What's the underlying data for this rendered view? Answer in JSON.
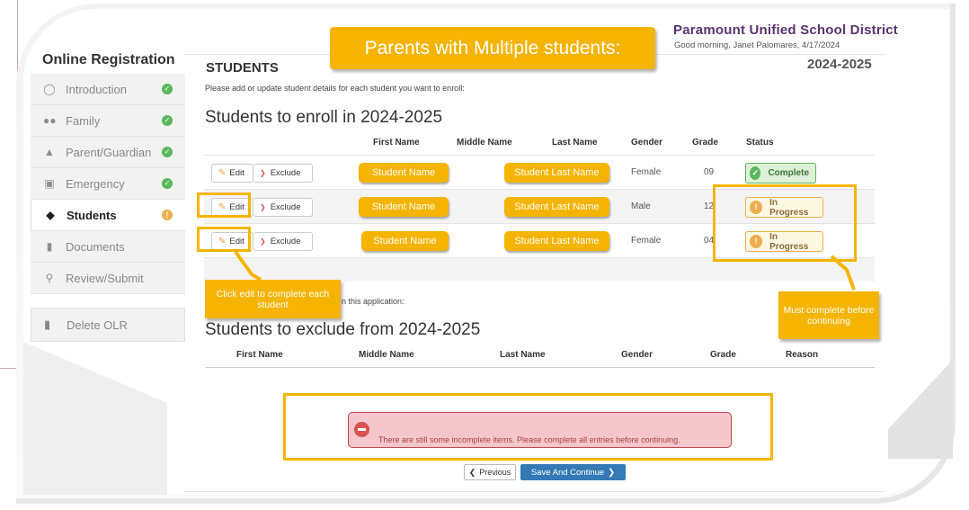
{
  "sidebar": {
    "title": "Online Registration",
    "items": [
      {
        "label": "Introduction",
        "icon": "lightbulb-icon",
        "state": "complete"
      },
      {
        "label": "Family",
        "icon": "users-icon",
        "state": "complete"
      },
      {
        "label": "Parent/Guardian",
        "icon": "user-icon",
        "state": "complete"
      },
      {
        "label": "Emergency",
        "icon": "ambulance-icon",
        "state": "complete"
      },
      {
        "label": "Students",
        "icon": "graduation-cap-icon",
        "state": "warning"
      },
      {
        "label": "Documents",
        "icon": "file-icon",
        "state": ""
      },
      {
        "label": "Review/Submit",
        "icon": "search-icon",
        "state": ""
      }
    ],
    "delete_label": "Delete OLR"
  },
  "header": {
    "district": "Paramount Unified School District",
    "greeting": "Good morning, Janet Palomares, 4/17/2024",
    "school_year": "2024-2025"
  },
  "page": {
    "heading": "STUDENTS",
    "instruction": "Please add or update student details for each student you want to enroll:",
    "enroll_title": "Students to enroll in 2024-2025",
    "exclude_instruction": "n this application:",
    "exclude_title": "Students to exclude from 2024-2025"
  },
  "enroll_table": {
    "columns": [
      "First Name",
      "Middle Name",
      "Last Name",
      "Gender",
      "Grade",
      "Status"
    ],
    "edit_label": "Edit",
    "exclude_label": "Exclude",
    "rows": [
      {
        "first": "Student Name",
        "last": "Student Last Name",
        "gender": "Female",
        "grade": "09",
        "status": "Complete"
      },
      {
        "first": "Student Name",
        "last": "Student Last Name",
        "gender": "Male",
        "grade": "12",
        "status": "In Progress"
      },
      {
        "first": "Student Name",
        "last": "Student Last Name",
        "gender": "Female",
        "grade": "04",
        "status": "In Progress"
      }
    ]
  },
  "exclude_table": {
    "columns": [
      "First Name",
      "Middle Name",
      "Last Name",
      "Gender",
      "Grade",
      "Reason"
    ]
  },
  "error": {
    "message": "There are still some incomplete items. Please complete all entries before continuing."
  },
  "nav": {
    "previous": "Previous",
    "next": "Save And Continue"
  },
  "annotations": {
    "title": "Parents with Multiple students:",
    "edit_callout": "Click edit to complete each student",
    "status_callout": "Must complete before continuing"
  },
  "colors": {
    "highlight": "#f5b400",
    "district": "#5a3370",
    "primary_button": "#337ab7",
    "complete": "#5cb85c",
    "warning": "#f0ad4e",
    "error": "#d9534f"
  }
}
